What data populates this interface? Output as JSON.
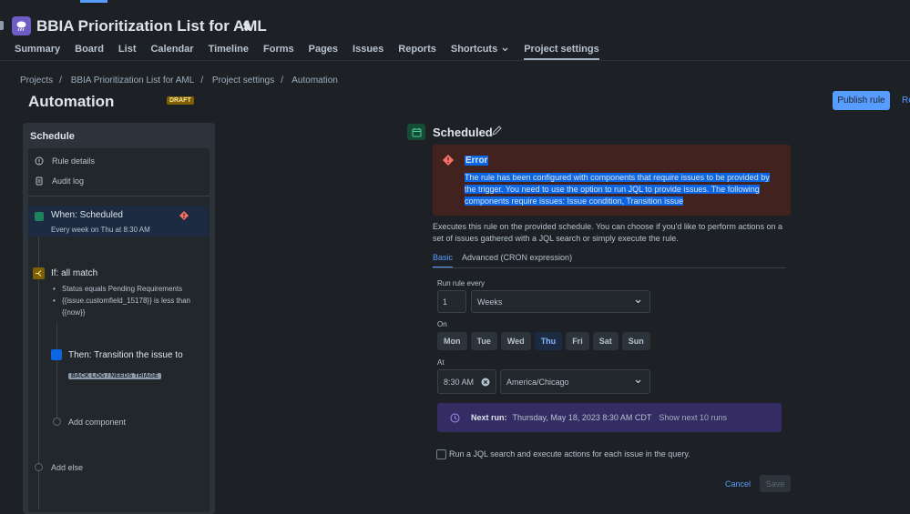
{
  "project": {
    "title": "BBIA Prioritization List for AML"
  },
  "nav": [
    {
      "label": "Summary"
    },
    {
      "label": "Board"
    },
    {
      "label": "List"
    },
    {
      "label": "Calendar"
    },
    {
      "label": "Timeline"
    },
    {
      "label": "Forms"
    },
    {
      "label": "Pages"
    },
    {
      "label": "Issues"
    },
    {
      "label": "Reports"
    },
    {
      "label": "Shortcuts"
    },
    {
      "label": "Project settings"
    }
  ],
  "breadcrumb": [
    "Projects",
    "BBIA Prioritization List for AML",
    "Project settings",
    "Automation"
  ],
  "page": {
    "title": "Automation",
    "badge": "DRAFT",
    "publish_label": "Publish rule",
    "cut_link": "Re"
  },
  "panel": {
    "title": "Schedule",
    "rule_details": "Rule details",
    "audit_log": "Audit log",
    "trigger_title": "When: Scheduled",
    "trigger_sub": "Every week on Thu at 8:30 AM",
    "condition_title": "If: all match",
    "conditions": [
      "Status equals Pending Requirements",
      "{{issue.customfield_15178}} is less than {{now}}"
    ],
    "action_title": "Then: Transition the issue to",
    "action_tag": "BACK LOG / NEEDS TRIAGE",
    "add_component": "Add component",
    "add_else": "Add else"
  },
  "config": {
    "title": "Scheduled",
    "error_title": "Error",
    "error_body": "The rule has been configured with components that require issues to be provided by the trigger. You need to use the option to run JQL to provide issues. The following components require issues: Issue condition, Transition issue",
    "description": "Executes this rule on the provided schedule. You can choose if you'd like to perform actions on a set of issues gathered with a JQL search or simply execute the rule.",
    "tabs": [
      "Basic",
      "Advanced (CRON expression)"
    ],
    "run_label": "Run rule every",
    "run_value": "1",
    "run_unit": "Weeks",
    "on_label": "On",
    "days": [
      "Mon",
      "Tue",
      "Wed",
      "Thu",
      "Fri",
      "Sat",
      "Sun"
    ],
    "selected_day": "Thu",
    "at_label": "At",
    "time": "8:30 AM",
    "timezone": "America/Chicago",
    "next_run_label": "Next run:",
    "next_run_value": "Thursday, May 18, 2023 8:30 AM CDT",
    "next_run_link": "Show next 10 runs",
    "jql_label": "Run a JQL search and execute actions for each issue in the query.",
    "cancel_label": "Cancel",
    "save_label": "Save"
  },
  "colors": {
    "accent": "#579dff",
    "error_bg": "#42221f",
    "draft": "#7f5f01",
    "selection": "#0c66e4"
  }
}
